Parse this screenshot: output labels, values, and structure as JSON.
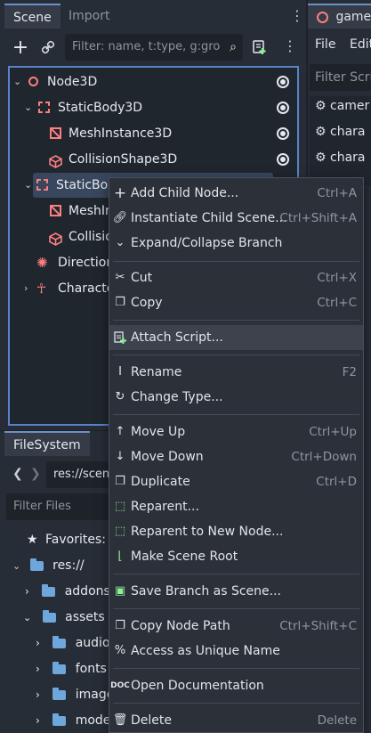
{
  "scene_dock": {
    "tabs": [
      "Scene",
      "Import"
    ],
    "filter_placeholder": "Filter: name, t:type, g:gro",
    "tree": [
      {
        "label": "Node3D"
      },
      {
        "label": "StaticBody3D"
      },
      {
        "label": "MeshInstance3D"
      },
      {
        "label": "CollisionShape3D"
      },
      {
        "label": "StaticBod"
      },
      {
        "label": "MeshIn"
      },
      {
        "label": "Collisio"
      },
      {
        "label": "Direction"
      },
      {
        "label": "Characte"
      }
    ]
  },
  "filesystem_dock": {
    "tab": "FileSystem",
    "path": "res://scen",
    "filter_placeholder": "Filter Files",
    "favorites": "Favorites:",
    "items": [
      "res://",
      "addons",
      "assets",
      "audio",
      "fonts",
      "images",
      "models"
    ]
  },
  "right_dock": {
    "tab": "game_",
    "menu": [
      "File",
      "Edit"
    ],
    "filter": "Filter Scri",
    "scripts": [
      "camer",
      "chara",
      "chara"
    ]
  },
  "context_menu": {
    "items": [
      {
        "label": "Add Child Node...",
        "shortcut": "Ctrl+A",
        "icon": "plus-icon"
      },
      {
        "label": "Instantiate Child Scene...",
        "shortcut": "Ctrl+Shift+A",
        "icon": "link-icon"
      },
      {
        "label": "Expand/Collapse Branch",
        "shortcut": "",
        "icon": "chevron-down-icon"
      },
      {
        "label": "Cut",
        "shortcut": "Ctrl+X",
        "icon": "scissors-icon"
      },
      {
        "label": "Copy",
        "shortcut": "Ctrl+C",
        "icon": "copy-icon"
      },
      {
        "label": "Attach Script...",
        "shortcut": "",
        "icon": "attach-script-icon"
      },
      {
        "label": "Rename",
        "shortcut": "F2",
        "icon": "rename-icon"
      },
      {
        "label": "Change Type...",
        "shortcut": "",
        "icon": "change-type-icon"
      },
      {
        "label": "Move Up",
        "shortcut": "Ctrl+Up",
        "icon": "arrow-up-icon"
      },
      {
        "label": "Move Down",
        "shortcut": "Ctrl+Down",
        "icon": "arrow-down-icon"
      },
      {
        "label": "Duplicate",
        "shortcut": "Ctrl+D",
        "icon": "duplicate-icon"
      },
      {
        "label": "Reparent...",
        "shortcut": "",
        "icon": "reparent-icon"
      },
      {
        "label": "Reparent to New Node...",
        "shortcut": "",
        "icon": "reparent-new-icon"
      },
      {
        "label": "Make Scene Root",
        "shortcut": "",
        "icon": "scene-root-icon"
      },
      {
        "label": "Save Branch as Scene...",
        "shortcut": "",
        "icon": "save-branch-icon"
      },
      {
        "label": "Copy Node Path",
        "shortcut": "Ctrl+Shift+C",
        "icon": "copy-path-icon"
      },
      {
        "label": "Access as Unique Name",
        "shortcut": "",
        "icon": "percent-icon"
      },
      {
        "label": "Open Documentation",
        "shortcut": "",
        "icon": "doc-icon"
      },
      {
        "label": "Delete",
        "shortcut": "Delete",
        "icon": "trash-icon"
      }
    ]
  },
  "colors": {
    "accent": "#5a82c7",
    "node3d_red": "#fc7f7f",
    "folder_blue": "#6ea7dc",
    "script_green": "#8eef97"
  }
}
